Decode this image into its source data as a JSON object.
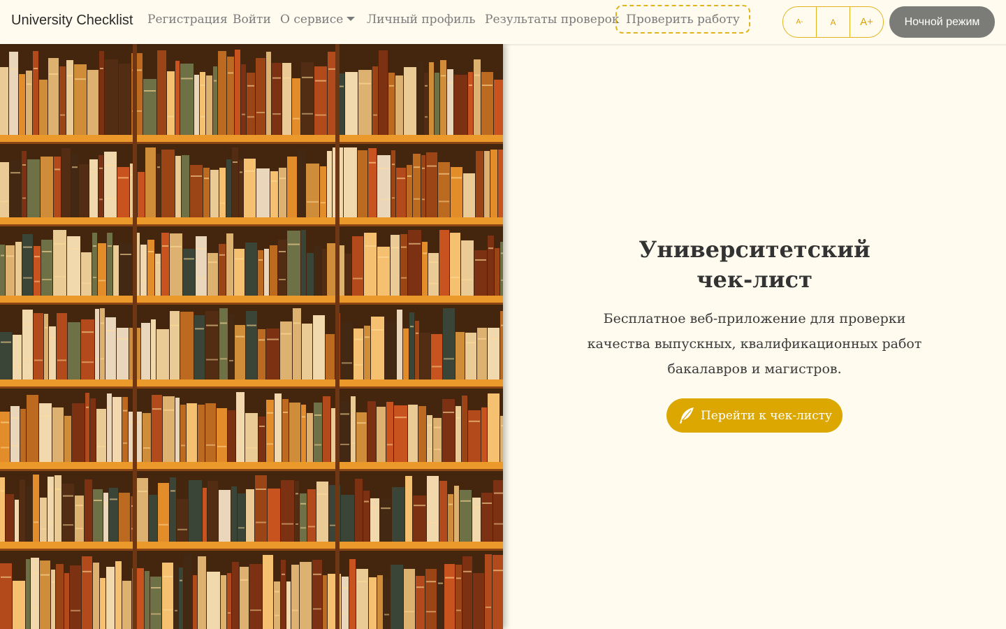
{
  "nav": {
    "brand": "University Checklist",
    "links": {
      "register": "Регистрация",
      "login": "Войти",
      "about": "О сервисе",
      "profile": "Личный профиль",
      "results": "Результаты проверок"
    },
    "check_work": "Проверить работу",
    "font_small": "A-",
    "font_normal": "A",
    "font_large": "A+",
    "night_mode": "Ночной режим"
  },
  "hero": {
    "image_icon": "bookshelf-photo",
    "title_line1": "Университетский",
    "title_line2": "чек-лист",
    "description_line1": "Бесплатное веб-приложение для проверки",
    "description_line2": "качества выпускных, квалификационных работ",
    "description_line3": "бакалавров и магистров.",
    "cta_label": "Перейти к чек-листу",
    "cta_icon": "feather-icon"
  },
  "colors": {
    "accent": "#dba700",
    "background": "#fffcef",
    "night_button": "#7b7b78"
  }
}
